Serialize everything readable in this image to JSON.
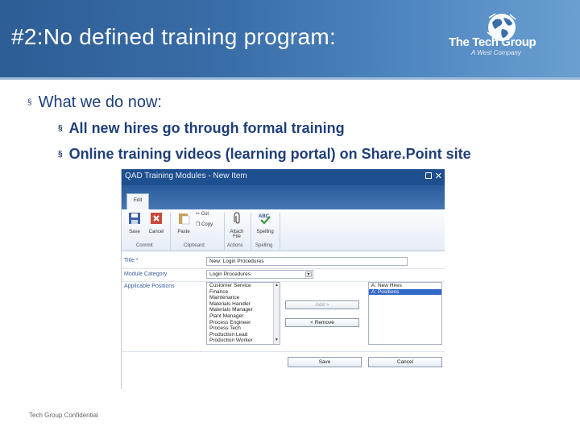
{
  "slide": {
    "title": "#2:No defined training program:",
    "footer": "Tech Group Confidential"
  },
  "logo": {
    "name": "The Tech Group",
    "tagline": "A West Company"
  },
  "bullets": [
    "What we do now:",
    "All new hires go through formal training",
    "Online training videos (learning portal) on Share.Point site"
  ],
  "bullet_marker": "§",
  "sharepoint": {
    "window_title": "QAD Training Modules - New Item",
    "tab": "Edit",
    "ribbon": {
      "save": "Save",
      "cancel": "Cancel",
      "paste": "Paste",
      "cut": "Cut",
      "copy": "Copy",
      "attach_file": "Attach File",
      "spelling": "Spelling",
      "groups": {
        "commit": "Commit",
        "clipboard": "Clipboard",
        "actions": "Actions",
        "spelling": "Spelling"
      }
    },
    "form": {
      "title_label": "Title *",
      "title_value": "New: Login Procedures",
      "module_label": "Module Category",
      "module_value": "Login Procedures",
      "positions_label": "Applicable Positions",
      "available_positions": [
        "Customer Service",
        "Finance",
        "Maintenance",
        "Materials Handler",
        "Materials Manager",
        "Plant Manager",
        "Process Engineer",
        "Process Tech",
        "Production Lead",
        "Production Worker"
      ],
      "selected_positions": [
        "A: New Hires",
        "A: Positions"
      ],
      "add_button": "Add >",
      "remove_button": "< Remove",
      "save_button": "Save",
      "cancel_button": "Cancel"
    }
  },
  "colors": {
    "banner": "#3a6ea8",
    "bullet_text": "#1f3f7a",
    "sp_titlebar": "#1e4f8f",
    "sp_selected": "#3169c6"
  }
}
